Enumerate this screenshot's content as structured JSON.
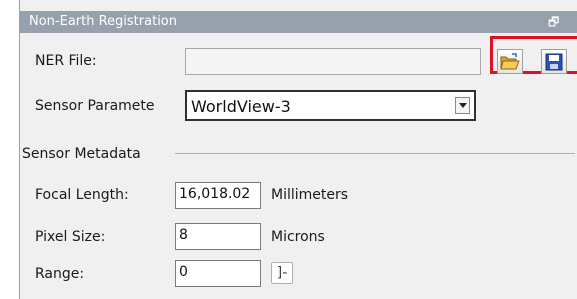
{
  "window": {
    "title": "Non-Earth Registration",
    "restore_glyph": "🗗"
  },
  "ner": {
    "label": "NER File:",
    "value": ""
  },
  "toolbar": {
    "open_icon": "folder-open-icon",
    "save_icon": "floppy-save-icon",
    "highlight_color": "#e01020"
  },
  "sensor": {
    "label": "Sensor Paramete",
    "selected": "WorldView-3",
    "arrow": "▾"
  },
  "metadata": {
    "group_label": "Sensor Metadata",
    "focal_length": {
      "label": "Focal Length:",
      "value": "16,018.02",
      "unit": "Millimeters"
    },
    "pixel_size": {
      "label": "Pixel Size:",
      "value": "8",
      "unit": "Microns"
    },
    "range": {
      "label": "Range:",
      "value": "0",
      "button_glyph": "]-"
    }
  }
}
